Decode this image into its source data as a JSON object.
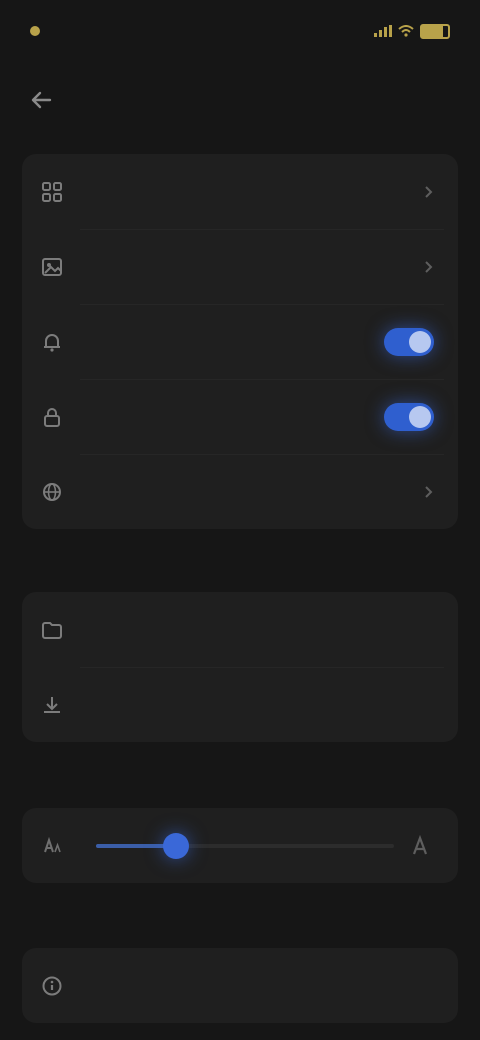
{
  "status_bar": {
    "time": "",
    "battery_level": 0.8,
    "accent": "#b8a24a"
  },
  "header": {
    "title": ""
  },
  "groups": {
    "main": {
      "items": [
        {
          "label": "",
          "value": "",
          "icon": "grid-icon",
          "control": "chevron"
        },
        {
          "label": "",
          "value": "",
          "icon": "image-icon",
          "control": "chevron"
        },
        {
          "label": "",
          "value": "",
          "icon": "bell-icon",
          "control": "toggle",
          "on": true
        },
        {
          "label": "",
          "value": "",
          "icon": "lock-icon",
          "control": "toggle",
          "on": true
        },
        {
          "label": "",
          "value": "",
          "icon": "globe-icon",
          "control": "chevron"
        }
      ]
    },
    "section2": {
      "label": "",
      "items": [
        {
          "label": "",
          "value": "",
          "icon": "folder-icon",
          "control": "none"
        },
        {
          "label": "",
          "value": "",
          "icon": "download-icon",
          "control": "value"
        }
      ]
    },
    "section3": {
      "label": "",
      "slider": {
        "label": "",
        "level": 0.27,
        "icon": "text-size-icon"
      }
    },
    "section4": {
      "label": "",
      "items": [
        {
          "label": "",
          "value": "",
          "icon": "info-icon",
          "control": "none"
        }
      ]
    }
  },
  "colors": {
    "background": "#161616",
    "card": "#1f1f1f",
    "toggle_on": "#2f5fcf",
    "status_accent": "#b8a24a"
  }
}
